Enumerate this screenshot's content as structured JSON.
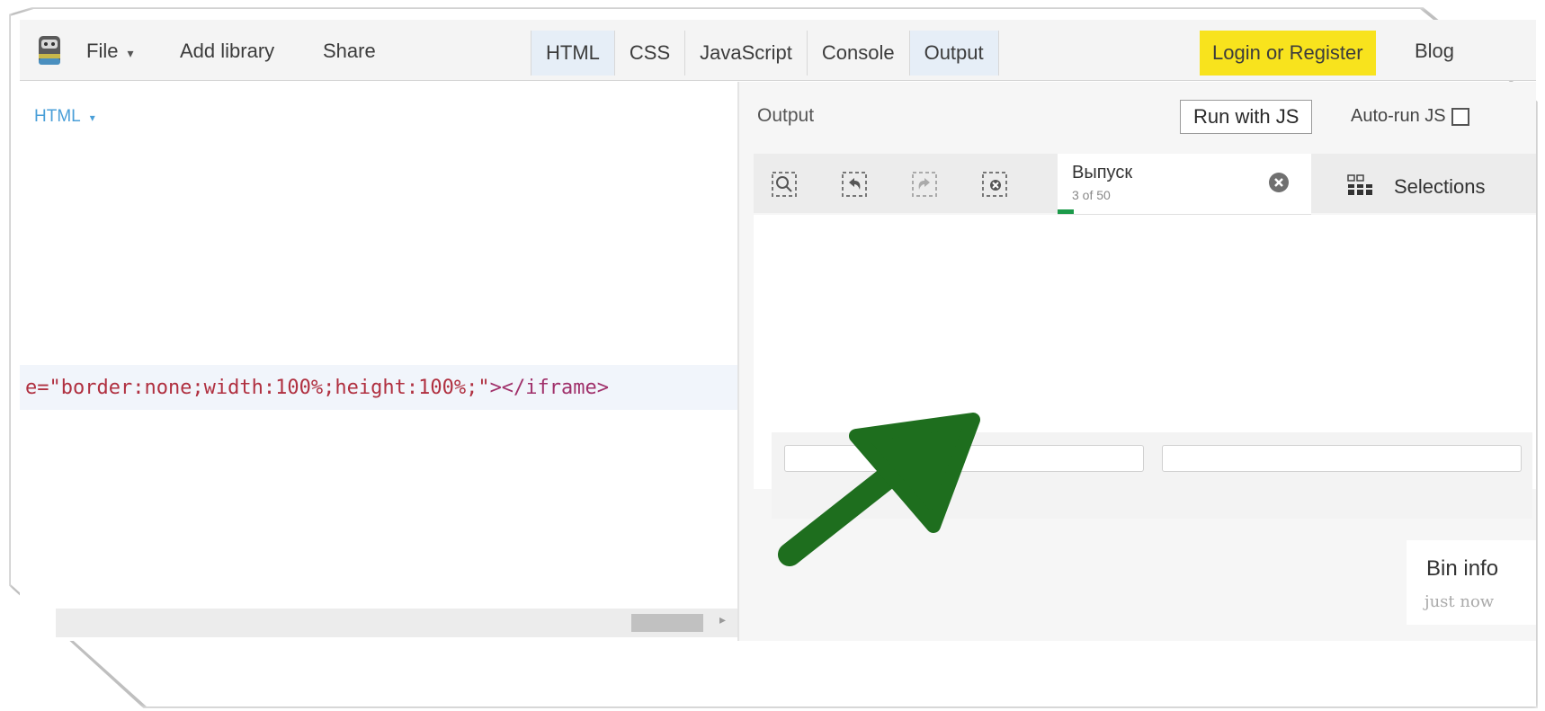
{
  "topbar": {
    "menu": [
      {
        "label": "File",
        "has_caret": true
      },
      {
        "label": "Add library"
      },
      {
        "label": "Share"
      }
    ],
    "tabs": [
      {
        "label": "HTML",
        "active": true
      },
      {
        "label": "CSS",
        "active": false
      },
      {
        "label": "JavaScript",
        "active": false
      },
      {
        "label": "Console",
        "active": false
      },
      {
        "label": "Output",
        "active": true
      }
    ],
    "login_label": "Login or Register",
    "login_color": "#f8e31d",
    "blog_label": "Blog"
  },
  "editor": {
    "pane_label": "HTML",
    "code_attr": "e=\"border:none;width:100%;height:100%;\"",
    "code_tag": "></iframe>"
  },
  "output": {
    "label": "Output",
    "run_label": "Run with JS",
    "autorun_label": "Auto-run JS",
    "autorun_checked": false,
    "toolbar": {
      "icons": [
        "zoom-select-icon",
        "undo-select-icon",
        "redo-select-icon",
        "clear-select-icon"
      ],
      "release_title": "Выпуск",
      "release_count": "3 of 50",
      "selections_label": "Selections"
    },
    "bin_info": {
      "title": "Bin info",
      "subtitle": "just now"
    },
    "annotation_arrow_color": "#1e6e1e"
  }
}
